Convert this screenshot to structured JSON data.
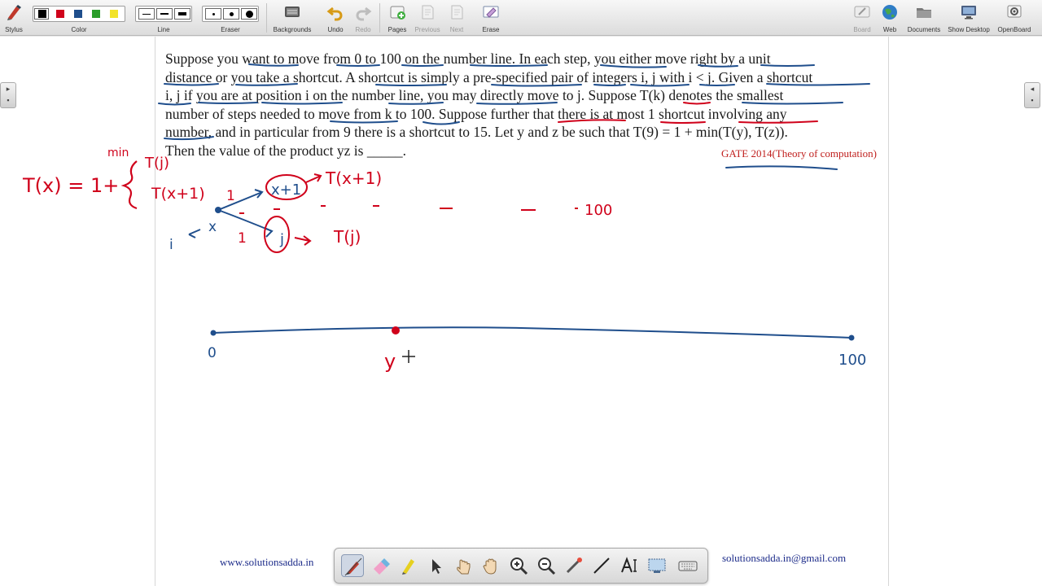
{
  "toolbar": {
    "stylus_label": "Stylus",
    "color_label": "Color",
    "line_label": "Line",
    "eraser_label": "Eraser",
    "backgrounds_label": "Backgrounds",
    "undo_label": "Undo",
    "redo_label": "Redo",
    "pages_label": "Pages",
    "previous_label": "Previous",
    "next_label": "Next",
    "erase_label": "Erase",
    "board_label": "Board",
    "web_label": "Web",
    "documents_label": "Documents",
    "show_desktop_label": "Show Desktop",
    "openboard_label": "OpenBoard",
    "colors": [
      "#000000",
      "#d0021b",
      "#1f4e8c",
      "#2a9d2a",
      "#f2e32a"
    ]
  },
  "problem": {
    "lines": [
      "Suppose you want to move from 0 to 100 on the number line. In each step, you either move right by a unit",
      "distance or you take a shortcut. A shortcut is simply a pre-specified pair of integers i, j with i < j. Given a shortcut",
      "i, j if you are at position i on the number line, you may directly move to j. Suppose T(k) denotes the smallest",
      "number of steps needed to move from k to 100. Suppose further that there is at most 1 shortcut involving any",
      "number, and in particular from 9 there is a shortcut to 15. Let y and z be such that T(9) = 1 + min(T(y), T(z)).",
      "Then the value of the product yz is _____."
    ],
    "source_tag": "GATE 2014(Theory of computation)"
  },
  "annotations": {
    "recurrence_lhs": "T(x) = 1+",
    "min_word": "min",
    "branch_top": "T(j)",
    "branch_bottom": "T(x+1)",
    "node_next": "x+1",
    "node_next_result": "T(x+1)",
    "node_jump": "j",
    "node_jump_result": "T(j)",
    "edge_one_top": "1",
    "edge_one_bottom": "1",
    "x_label": "x",
    "i_label": "i",
    "hundred_label": "100",
    "numberline_start": "0",
    "numberline_end": "100",
    "numberline_mark": "y"
  },
  "footer": {
    "website": "www.solutionsadda.in",
    "email": "solutionsadda.in@gmail.com"
  },
  "ink_colors": {
    "red": "#d0021b",
    "blue": "#1f4e8c"
  }
}
